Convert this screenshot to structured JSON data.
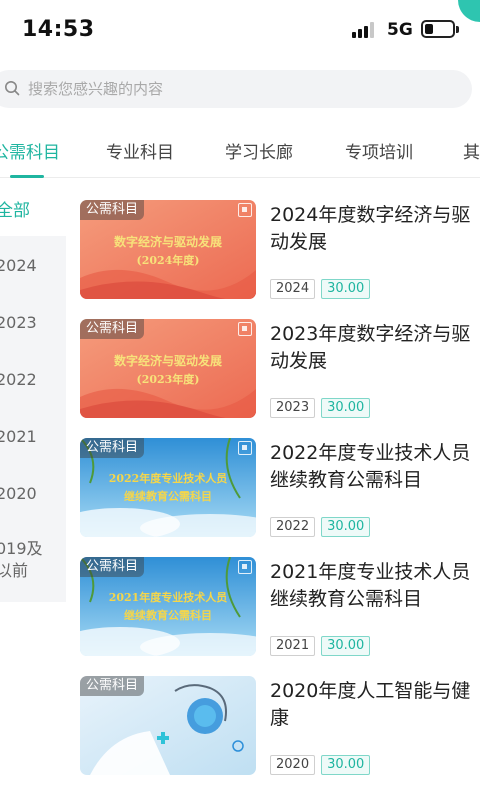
{
  "status": {
    "time": "14:53",
    "network": "5G"
  },
  "search": {
    "placeholder": "搜索您感兴趣的内容"
  },
  "tabs": [
    {
      "label": "公需科目",
      "active": true
    },
    {
      "label": "专业科目"
    },
    {
      "label": "学习长廊"
    },
    {
      "label": "专项培训"
    },
    {
      "label": "其"
    }
  ],
  "filter": {
    "all_label": "全部",
    "years": [
      "2024",
      "2023",
      "2022",
      "2021",
      "2020"
    ],
    "earlier_line1": "019及",
    "earlier_line2": "以前"
  },
  "courses": [
    {
      "tag": "公需科目",
      "title": "2024年度数字经济与驱动发展",
      "year": "2024",
      "hours": "30.00",
      "thumb_line1": "数字经济与驱动发展",
      "thumb_line2": "(2024年度)"
    },
    {
      "tag": "公需科目",
      "title": "2023年度数字经济与驱动发展",
      "year": "2023",
      "hours": "30.00",
      "thumb_line1": "数字经济与驱动发展",
      "thumb_line2": "(2023年度)"
    },
    {
      "tag": "公需科目",
      "title": "2022年度专业技术人员继续教育公需科目",
      "year": "2022",
      "hours": "30.00",
      "thumb_line1": "2022年度专业技术人员",
      "thumb_line2": "继续教育公需科目"
    },
    {
      "tag": "公需科目",
      "title": "2021年度专业技术人员继续教育公需科目",
      "year": "2021",
      "hours": "30.00",
      "thumb_line1": "2021年度专业技术人员",
      "thumb_line2": "继续教育公需科目"
    },
    {
      "tag": "公需科目",
      "title": "2020年度人工智能与健康",
      "year": "2020",
      "hours": "30.00",
      "thumb_line1": "",
      "thumb_line2": ""
    }
  ],
  "colors": {
    "accent": "#1fb5a0",
    "red_banner": "#f07a5a",
    "sky_banner": "#58b4e8"
  }
}
